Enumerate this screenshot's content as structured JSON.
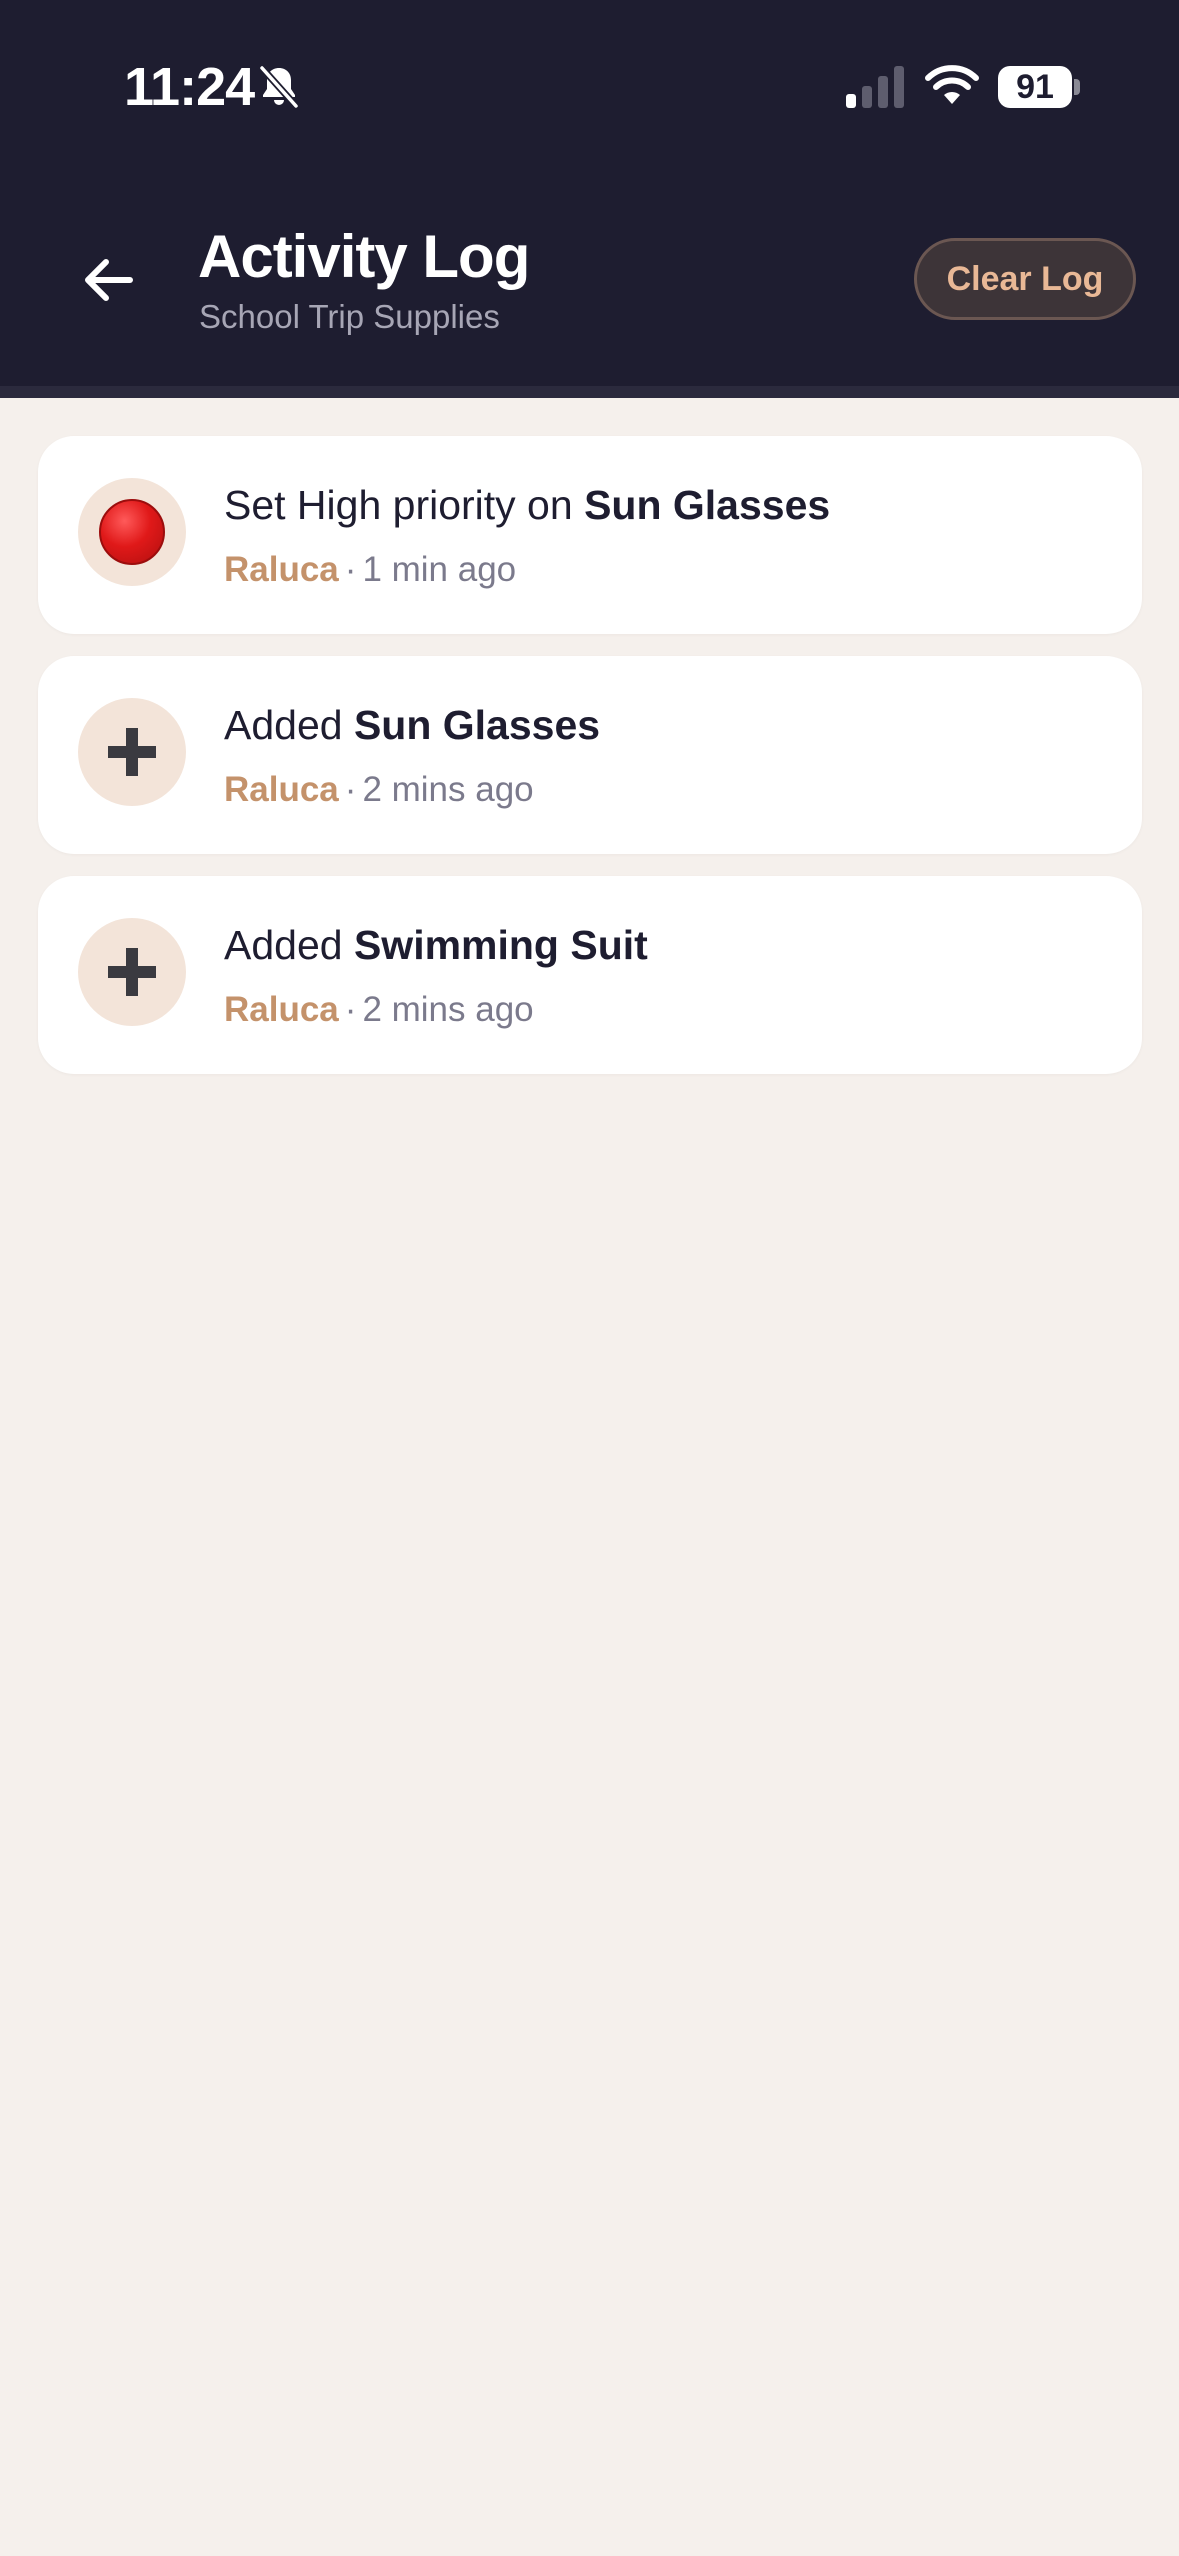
{
  "status_bar": {
    "time": "11:24",
    "battery": "91"
  },
  "header": {
    "title": "Activity Log",
    "subtitle": "School Trip Supplies",
    "clear_label": "Clear Log"
  },
  "activities": [
    {
      "icon": "red-circle-icon",
      "action": "Set High priority on ",
      "item": "Sun Glasses",
      "user": "Raluca",
      "separator": "·",
      "time": "1 min ago"
    },
    {
      "icon": "plus-icon",
      "action": "Added ",
      "item": "Sun Glasses",
      "user": "Raluca",
      "separator": "·",
      "time": "2 mins ago"
    },
    {
      "icon": "plus-icon",
      "action": "Added ",
      "item": "Swimming Suit",
      "user": "Raluca",
      "separator": "·",
      "time": "2 mins ago"
    }
  ],
  "colors": {
    "header_bg": "#1e1d30",
    "page_bg": "#f5f0ec",
    "accent": "#c4926b",
    "icon_bg": "#f3e4d9"
  }
}
